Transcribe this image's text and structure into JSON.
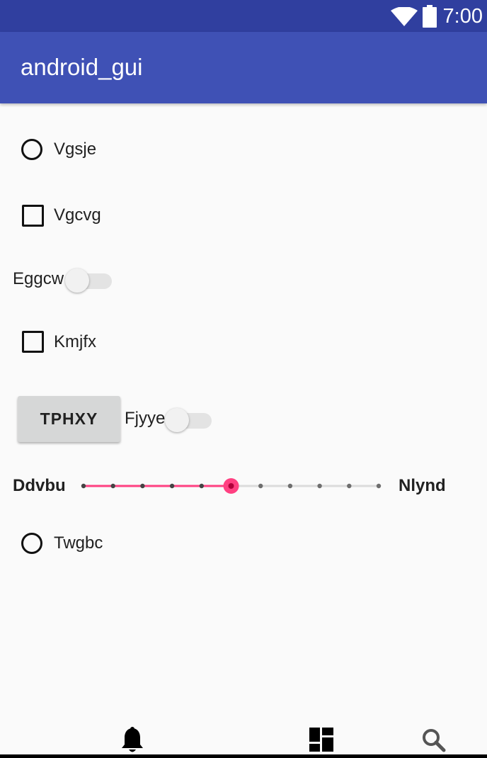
{
  "status_bar": {
    "time": "7:00",
    "icons": [
      "wifi-icon",
      "battery-icon"
    ]
  },
  "app_bar": {
    "title": "android_gui"
  },
  "widgets": {
    "radio_1": {
      "label": "Vgsje",
      "checked": false
    },
    "checkbox_1": {
      "label": "Vgcvg",
      "checked": false
    },
    "switch_1": {
      "label": "Eggcw",
      "on": false
    },
    "checkbox_2": {
      "label": "Kmjfx",
      "checked": false
    },
    "button_1": {
      "label": "TPHXY"
    },
    "switch_2": {
      "label": "Fjyye",
      "on": false
    },
    "seekbar": {
      "min_label": "Ddvbu",
      "max_label": "Nlynd",
      "steps": 10,
      "value": 5
    },
    "radio_2": {
      "label": "Twgbc",
      "checked": false
    }
  },
  "bottom_nav": {
    "icons": [
      "bell-icon",
      "dashboard-icon",
      "search-icon"
    ]
  },
  "colors": {
    "status_bar": "#303f9f",
    "app_bar": "#3f51b5",
    "accent": "#ff4081",
    "background": "#fafafa"
  }
}
